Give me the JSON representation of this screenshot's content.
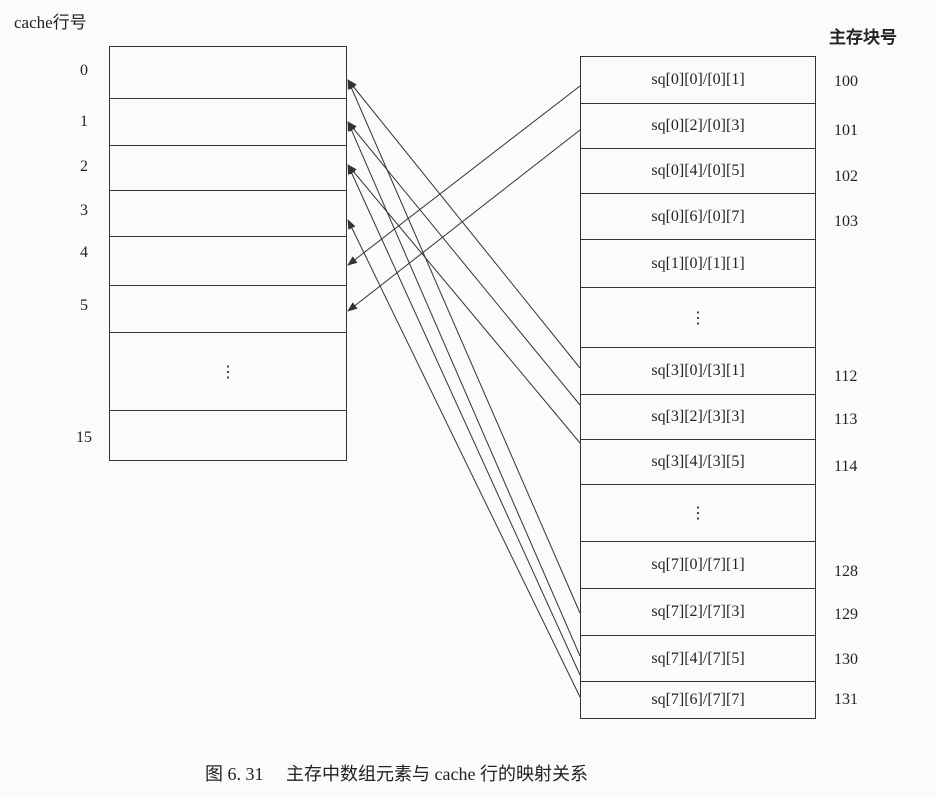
{
  "header": {
    "cache_title": "cache行号",
    "memory_title": "主存块号"
  },
  "cache_rows": [
    "0",
    "1",
    "2",
    "3",
    "4",
    "5",
    "⋮",
    "15"
  ],
  "memory_blocks": [
    {
      "label": "sq[0][0]/[0][1]",
      "block": "100"
    },
    {
      "label": "sq[0][2]/[0][3]",
      "block": "101"
    },
    {
      "label": "sq[0][4]/[0][5]",
      "block": "102"
    },
    {
      "label": "sq[0][6]/[0][7]",
      "block": "103"
    },
    {
      "label": "sq[1][0]/[1][1]",
      "block": ""
    },
    {
      "label": "⋮",
      "block": ""
    },
    {
      "label": "sq[3][0]/[3][1]",
      "block": "112"
    },
    {
      "label": "sq[3][2]/[3][3]",
      "block": "113"
    },
    {
      "label": "sq[3][4]/[3][5]",
      "block": "114"
    },
    {
      "label": "⋮",
      "block": ""
    },
    {
      "label": "sq[7][0]/[7][1]",
      "block": "128"
    },
    {
      "label": "sq[7][2]/[7][3]",
      "block": "129"
    },
    {
      "label": "sq[7][4]/[7][5]",
      "block": "130"
    },
    {
      "label": "sq[7][6]/[7][7]",
      "block": "131"
    }
  ],
  "mappings": [
    {
      "from_block": "100",
      "to_row": "4"
    },
    {
      "from_block": "101",
      "to_row": "5"
    },
    {
      "from_block": "112",
      "to_row": "0"
    },
    {
      "from_block": "113",
      "to_row": "1"
    },
    {
      "from_block": "114",
      "to_row": "2"
    },
    {
      "from_block": "128",
      "to_row": "0"
    },
    {
      "from_block": "129",
      "to_row": "1"
    },
    {
      "from_block": "130",
      "to_row": "2"
    },
    {
      "from_block": "131",
      "to_row": "3"
    }
  ],
  "caption": "图 6. 31　 主存中数组元素与 cache 行的映射关系"
}
